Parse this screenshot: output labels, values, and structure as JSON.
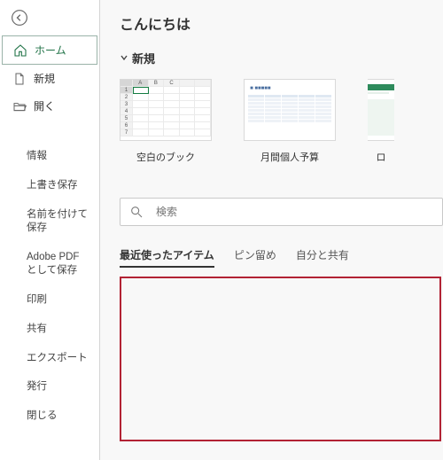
{
  "sidebar": {
    "primary": [
      {
        "label": "ホーム",
        "icon": "home-icon",
        "selected": true
      },
      {
        "label": "新規",
        "icon": "new-doc-icon",
        "selected": false
      },
      {
        "label": "開く",
        "icon": "folder-open-icon",
        "selected": false
      }
    ],
    "secondary": [
      "情報",
      "上書き保存",
      "名前を付けて保存",
      "Adobe PDF として保存",
      "印刷",
      "共有",
      "エクスポート",
      "発行",
      "閉じる"
    ]
  },
  "main": {
    "greeting": "こんにちは",
    "new_section": "新規",
    "templates": [
      {
        "label": "空白のブック",
        "kind": "blank"
      },
      {
        "label": "月間個人予算",
        "kind": "budget"
      },
      {
        "label": "ロ",
        "kind": "loan"
      }
    ],
    "search_placeholder": "検索",
    "tabs": [
      {
        "label": "最近使ったアイテム",
        "active": true
      },
      {
        "label": "ピン留め",
        "active": false
      },
      {
        "label": "自分と共有",
        "active": false
      }
    ]
  }
}
